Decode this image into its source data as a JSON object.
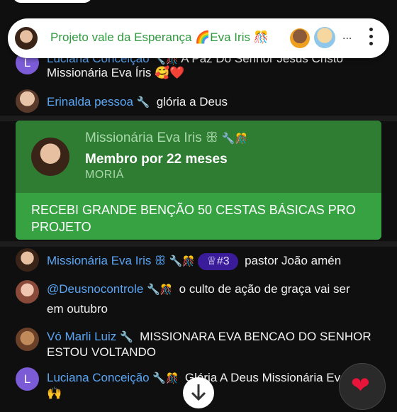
{
  "header": {
    "title": "Projeto vale da Esperança 🌈Eva Iris 🎊",
    "more_label": "..."
  },
  "messages": [
    {
      "author": "Luciana Conceição",
      "text": "A Paz Do Senhor Jesus Cristo",
      "avatar_letter": "L"
    },
    {
      "text_line2": "Missionária Eva Íris 🥰❤️"
    },
    {
      "author": "Erinalda pessoa",
      "text": "glória a Deus"
    },
    {
      "author": "Missionária Eva Iris ꕥ",
      "badge": "♕#3",
      "text": "pastor João amén"
    },
    {
      "author": "@Deusnocontrole",
      "text": "o culto de ação de graça vai ser",
      "text_line2": "em outubro"
    },
    {
      "author": "Vó Marli Luiz",
      "text": "MISSIONARA EVA BENCAO DO SENHOR",
      "text_line2": "ESTOU VOLTANDO"
    },
    {
      "author": "Luciana Conceição",
      "text": "Glória A Deus Missionária Eva",
      "avatar_letter": "L",
      "text_line2": "🙌"
    }
  ],
  "superchat": {
    "author": "Missionária Eva Iris ꕥ",
    "member": "Membro por 22 meses",
    "tier": "MORIÁ",
    "body": "RECEBI GRANDE BENÇÃO 50 CESTAS BÁSICAS PRO PROJETO"
  },
  "icons": {
    "wrench": "wrench-icon",
    "bottle": "moderator-bottle-icon",
    "heart": "heart-icon",
    "chevron": "scroll-down-icon"
  },
  "colors": {
    "author": "#5aa6f5",
    "card_top": "#2f7d33",
    "card_bottom": "#36a242",
    "header_title": "#2e9a3e"
  }
}
